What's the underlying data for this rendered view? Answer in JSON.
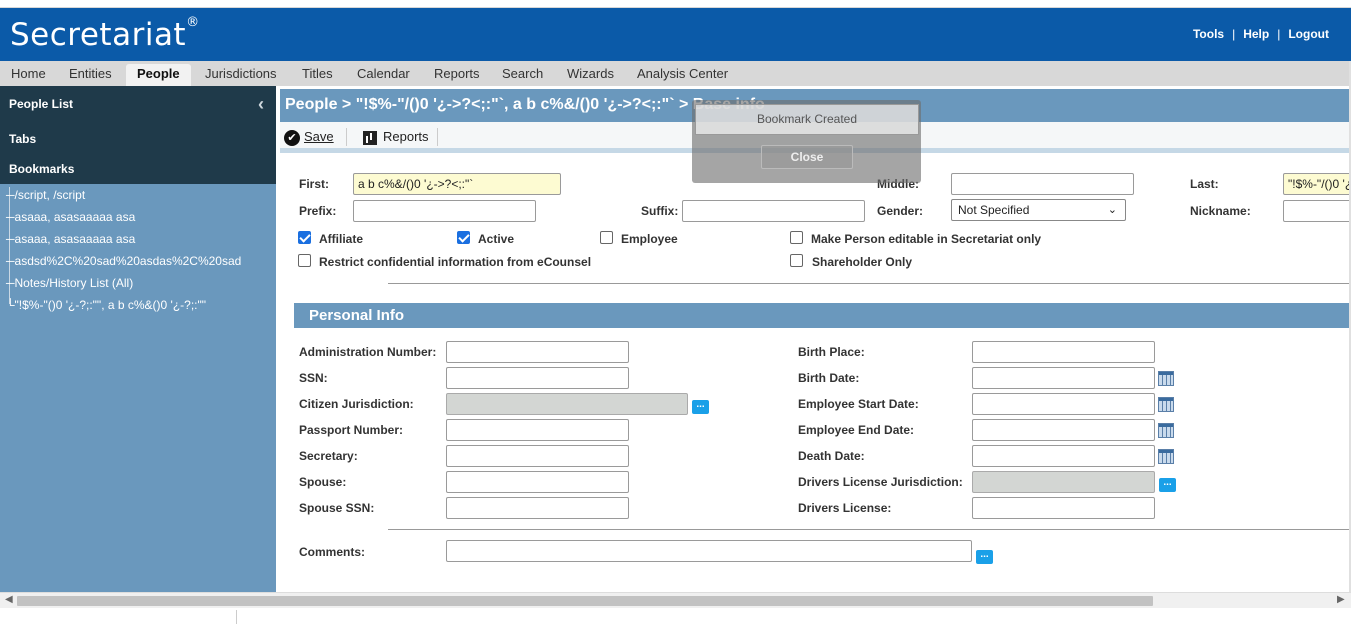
{
  "app": {
    "logo_text": "Secretariat",
    "logo_mark": "®"
  },
  "top_links": [
    "Tools",
    "Help",
    "Logout"
  ],
  "nav_tabs": [
    "Home",
    "Entities",
    "People",
    "Jurisdictions",
    "Titles",
    "Calendar",
    "Reports",
    "Search",
    "Wizards",
    "Analysis Center"
  ],
  "active_tab": "People",
  "sidebar": {
    "people_list": "People List",
    "tabs": "Tabs",
    "bookmarks": "Bookmarks",
    "bookmark_items": [
      "/script, /script",
      "asaaa, asasaaaaa asa",
      "asaaa, asasaaaaa asa",
      "asdsd%2C%20sad%20asdas%2C%20sad",
      "Notes/History List (All)",
      "\"!$%-\"()0 '¿-?;:\"\", a b c%&()0 '¿-?;:\"\""
    ],
    "collapse_icon": "‹"
  },
  "page_title": "People > \"!$%-\"/()0 '¿->?<;:\"`, a b c%&/()0 '¿->?<;:\"` > Base info",
  "toolbar": {
    "save_label": "Save",
    "reports_label": "Reports"
  },
  "base_info": {
    "first_label": "First:",
    "first_value": "a b c%&/()0 '¿->?<;:\"`",
    "middle_label": "Middle:",
    "middle_value": "",
    "last_label": "Last:",
    "last_value": "\"!$%-\"/()0 '¿",
    "prefix_label": "Prefix:",
    "suffix_label": "Suffix:",
    "gender_label": "Gender:",
    "gender_value": "Not Specified",
    "nickname_label": "Nickname:",
    "checkboxes": [
      {
        "label": "Affiliate",
        "checked": true
      },
      {
        "label": "Active",
        "checked": true
      },
      {
        "label": "Employee",
        "checked": false
      },
      {
        "label": "Make Person editable in Secretariat only",
        "checked": false
      },
      {
        "label": "Restrict confidential information from eCounsel",
        "checked": false
      },
      {
        "label": "Shareholder Only",
        "checked": false
      }
    ]
  },
  "personal_info": {
    "section_title": "Personal Info",
    "left_fields": [
      "Administration Number:",
      "SSN:",
      "Citizen Jurisdiction:",
      "Passport Number:",
      "Secretary:",
      "Spouse:",
      "Spouse SSN:"
    ],
    "right_fields": [
      "Birth Place:",
      "Birth Date:",
      "Employee Start Date:",
      "Employee End Date:",
      "Death Date:",
      "Drivers License Jurisdiction:",
      "Drivers License:"
    ],
    "comments_label": "Comments:"
  },
  "modal": {
    "message": "Bookmark Created",
    "close_label": "Close"
  },
  "colors": {
    "header_blue": "#0b5aa8",
    "panel_blue": "#6a98bd",
    "sidebar_dark": "#1f3a4a"
  }
}
